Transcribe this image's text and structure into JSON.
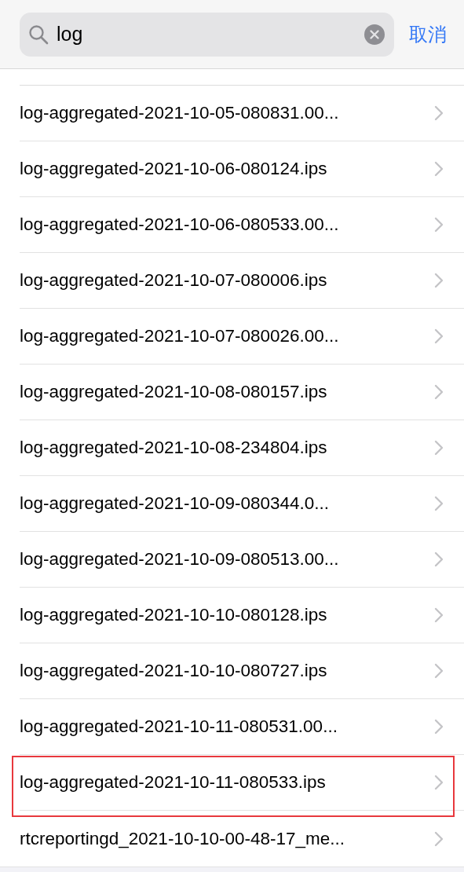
{
  "search": {
    "value": "log",
    "cancel": "取消"
  },
  "rows": [
    {
      "name": "log-aggregated-2021-10-05-080831.00...",
      "highlighted": false
    },
    {
      "name": "log-aggregated-2021-10-06-080124.ips",
      "highlighted": false
    },
    {
      "name": "log-aggregated-2021-10-06-080533.00...",
      "highlighted": false
    },
    {
      "name": "log-aggregated-2021-10-07-080006.ips",
      "highlighted": false
    },
    {
      "name": "log-aggregated-2021-10-07-080026.00...",
      "highlighted": false
    },
    {
      "name": "log-aggregated-2021-10-08-080157.ips",
      "highlighted": false
    },
    {
      "name": "log-aggregated-2021-10-08-234804.ips",
      "highlighted": false
    },
    {
      "name": "log-aggregated-2021-10-09-080344.0...",
      "highlighted": false
    },
    {
      "name": "log-aggregated-2021-10-09-080513.00...",
      "highlighted": false
    },
    {
      "name": "log-aggregated-2021-10-10-080128.ips",
      "highlighted": false
    },
    {
      "name": "log-aggregated-2021-10-10-080727.ips",
      "highlighted": false
    },
    {
      "name": "log-aggregated-2021-10-11-080531.00...",
      "highlighted": false
    },
    {
      "name": "log-aggregated-2021-10-11-080533.ips",
      "highlighted": true
    },
    {
      "name": "rtcreportingd_2021-10-10-00-48-17_me...",
      "highlighted": false
    }
  ]
}
